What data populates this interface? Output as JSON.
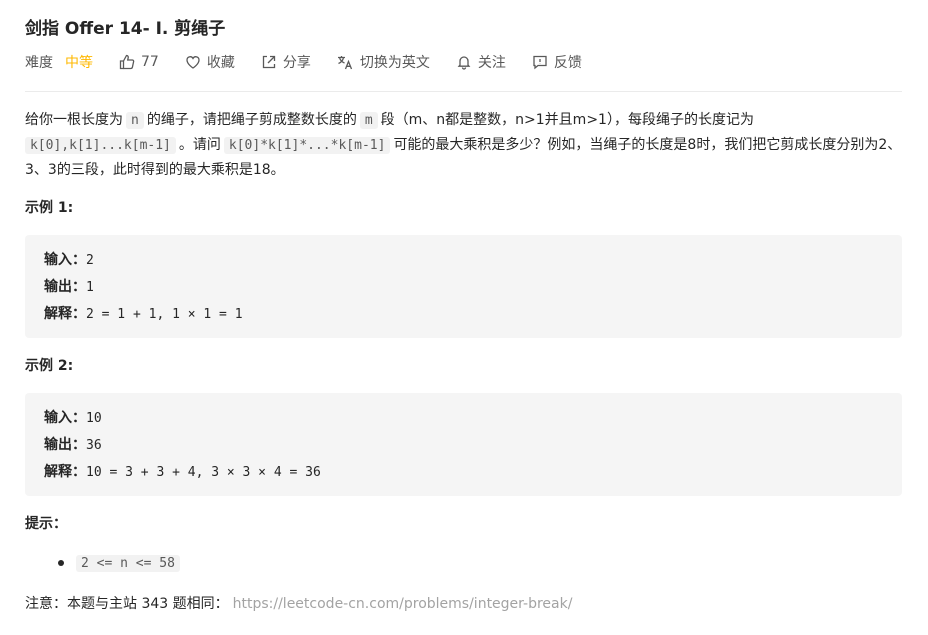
{
  "problem": {
    "title": "剑指 Offer 14- I. 剪绳子"
  },
  "meta": {
    "difficulty_label": "难度",
    "difficulty_value": "中等",
    "likes": "77",
    "collect_label": "收藏",
    "share_label": "分享",
    "switch_lang_label": "切换为英文",
    "follow_label": "关注",
    "feedback_label": "反馈",
    "difficulty_color": "#ffb800"
  },
  "description": {
    "p1_a": "给你一根长度为",
    "p1_code_n": "n",
    "p1_b": "的绳子，请把绳子剪成整数长度的",
    "p1_code_m": "m",
    "p1_c": "段（m、n都是整数，n>1并且m>1），每段绳子的长度记为",
    "p1_code_k": "k[0],k[1]...k[m-1]",
    "p1_d": "。请问",
    "p1_code_prod": "k[0]*k[1]*...*k[m-1]",
    "p1_e": "可能的最大乘积是多少？例如，当绳子的长度是8时，我们把它剪成长度分别为2、3、3的三段，此时得到的最大乘积是18。"
  },
  "examples": [
    {
      "title": "示例 1:",
      "input_label": "输入：",
      "input": "2",
      "output_label": "输出：",
      "output": "1",
      "explain_label": "解释：",
      "explain": "2 = 1 + 1, 1 × 1 = 1"
    },
    {
      "title": "示例 2:",
      "input_label": "输入：",
      "input": "10",
      "output_label": "输出：",
      "output": "36",
      "explain_label": "解释：",
      "explain": "10 = 3 + 3 + 4, 3 × 3 × 4 = 36"
    }
  ],
  "hints": {
    "title": "提示：",
    "items": [
      "2 <= n <= 58"
    ]
  },
  "note": {
    "text": "注意：本题与主站 343 题相同：",
    "link": "https://leetcode-cn.com/problems/integer-break/"
  }
}
